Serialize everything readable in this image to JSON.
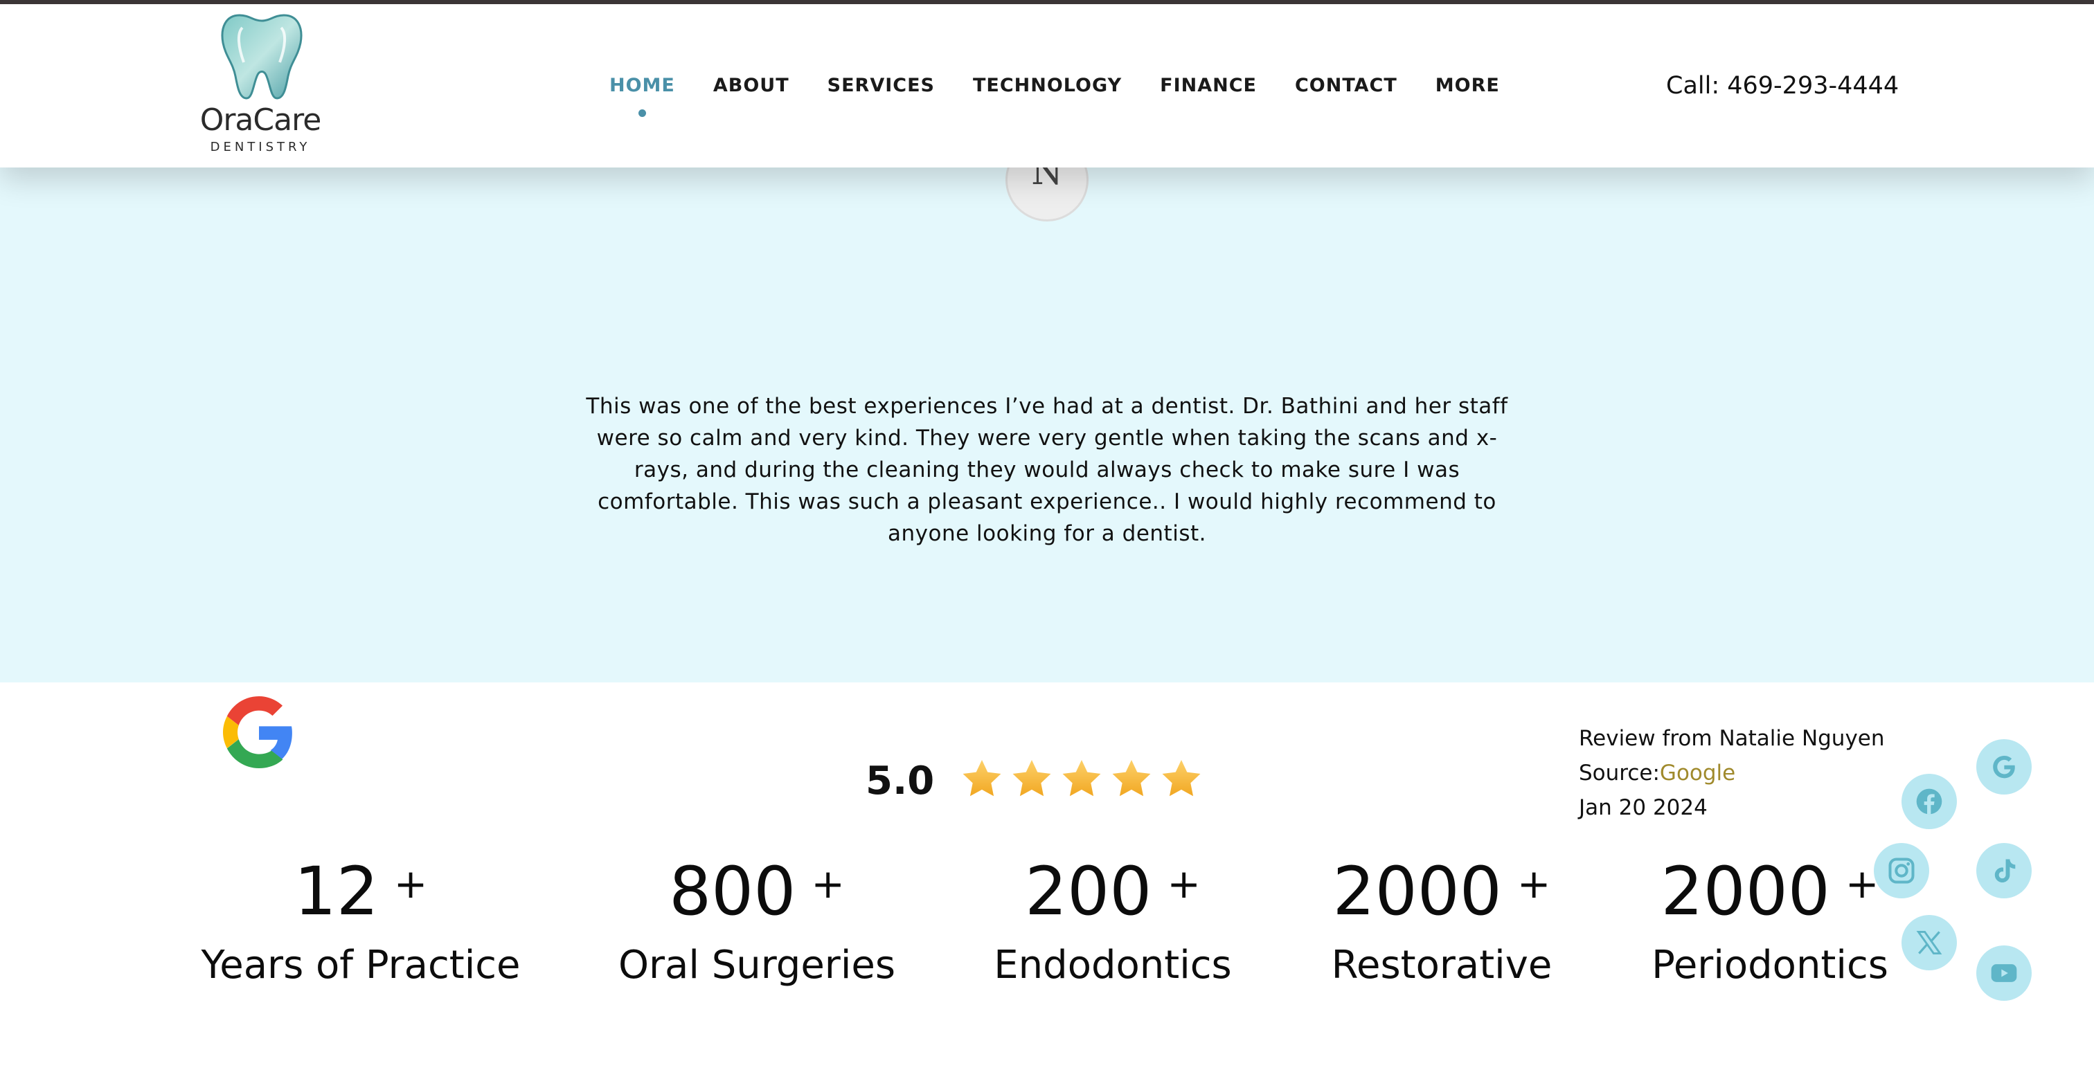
{
  "header": {
    "logo": {
      "name": "OraCare",
      "subtitle": "DENTISTRY"
    },
    "nav": [
      {
        "label": "HOME",
        "active": true
      },
      {
        "label": "ABOUT",
        "active": false
      },
      {
        "label": "SERVICES",
        "active": false
      },
      {
        "label": "TECHNOLOGY",
        "active": false
      },
      {
        "label": "FINANCE",
        "active": false
      },
      {
        "label": "CONTACT",
        "active": false
      },
      {
        "label": "MORE",
        "active": false
      }
    ],
    "call": "Call: 469-293-4444"
  },
  "review": {
    "avatar_letter": "N",
    "text": "This was one of the best experiences I’ve had at a dentist. Dr. Bathini and her staff were so calm and very kind. They were very gentle when taking the scans and x-rays, and during the cleaning they would always check to make sure I was comfortable. This was such a pleasant experience.. I would highly recommend to anyone looking for a dentist.",
    "score": "5.0",
    "stars": 5,
    "reviewer": "Review from Natalie Nguyen",
    "source_prefix": "Source:",
    "source": "Google",
    "date": "Jan 20 2024"
  },
  "stats": [
    {
      "number": "12",
      "plus": "+",
      "label": "Years of Practice"
    },
    {
      "number": "800",
      "plus": "+",
      "label": "Oral Surgeries"
    },
    {
      "number": "200",
      "plus": "+",
      "label": "Endodontics"
    },
    {
      "number": "2000",
      "plus": "+",
      "label": "Restorative"
    },
    {
      "number": "2000",
      "plus": "+",
      "label": "Periodontics"
    }
  ],
  "social": [
    {
      "name": "google-icon"
    },
    {
      "name": "facebook-icon"
    },
    {
      "name": "instagram-icon"
    },
    {
      "name": "tiktok-icon"
    },
    {
      "name": "x-icon"
    },
    {
      "name": "youtube-icon"
    }
  ],
  "colors": {
    "accent": "#4a90a8",
    "review_band": "#e4f8fc",
    "source_link": "#a08a2c",
    "social_bg": "#b8e7f1",
    "star": "#f5b82e"
  }
}
